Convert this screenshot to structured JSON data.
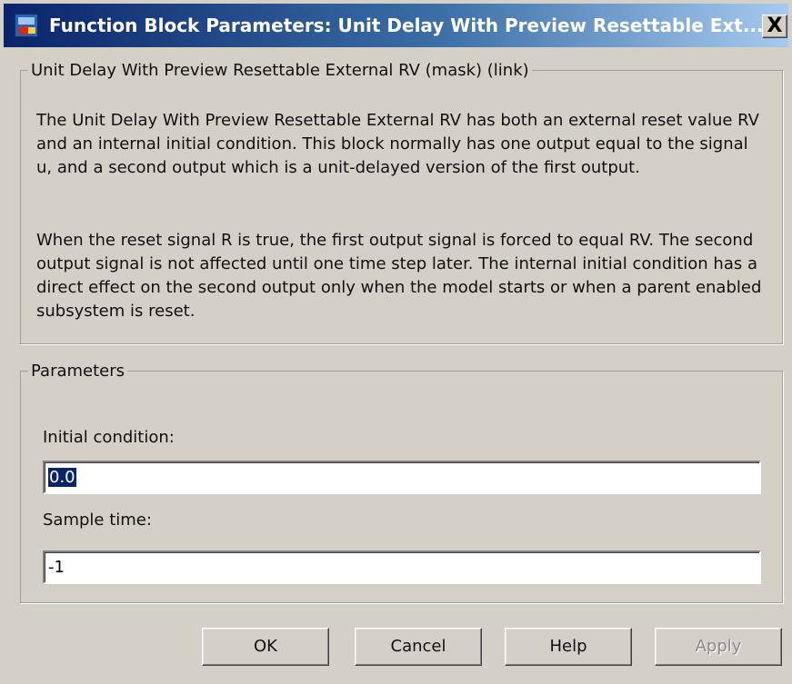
{
  "window": {
    "title": "Function Block Parameters: Unit Delay With Preview Resettable Ext...",
    "close_label": "X"
  },
  "description": {
    "legend": "Unit Delay With Preview Resettable External RV (mask) (link)",
    "paragraphs": [
      "The Unit Delay With Preview Resettable External RV has both an external reset value RV and an internal initial condition.  This block normally has one output equal to the signal u, and a second output which is a unit-delayed version of the first output.",
      "When the reset signal R is true, the first output signal is forced to equal RV. The second output signal is not affected until one time step later. The internal initial condition has a direct effect on the second output only when the model starts or when a parent enabled subsystem is reset."
    ]
  },
  "parameters": {
    "legend": "Parameters",
    "initial_condition": {
      "label": "Initial condition:",
      "value": "0.0"
    },
    "sample_time": {
      "label": "Sample time:",
      "value": "-1"
    }
  },
  "buttons": {
    "ok": "OK",
    "cancel": "Cancel",
    "help": "Help",
    "apply": "Apply"
  },
  "colors": {
    "title_bar_start": "#0a246a",
    "title_bar_end": "#a6caf0",
    "dialog_face": "#d4d0c8",
    "selection": "#0a246a"
  }
}
